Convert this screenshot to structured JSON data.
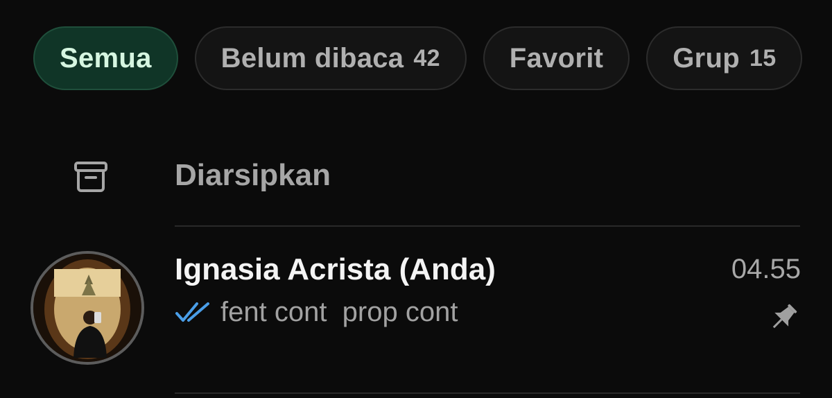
{
  "filters": [
    {
      "label": "Semua",
      "count": "",
      "active": true
    },
    {
      "label": "Belum dibaca",
      "count": "42",
      "active": false
    },
    {
      "label": "Favorit",
      "count": "",
      "active": false
    },
    {
      "label": "Grup",
      "count": "15",
      "active": false
    }
  ],
  "archived": {
    "icon": "archive-icon",
    "label": "Diarsipkan"
  },
  "chat": {
    "name": "Ignasia Acrista (Anda)",
    "time": "04.55",
    "status_icon": "double-check-icon",
    "preview": "fent cont  prop cont",
    "pinned": true,
    "pin_icon": "pin-icon"
  },
  "colors": {
    "background": "#0b0b0b",
    "active_chip_bg": "#103527",
    "active_chip_text": "#d6f6e1",
    "read_tick": "#4a9ee8"
  }
}
